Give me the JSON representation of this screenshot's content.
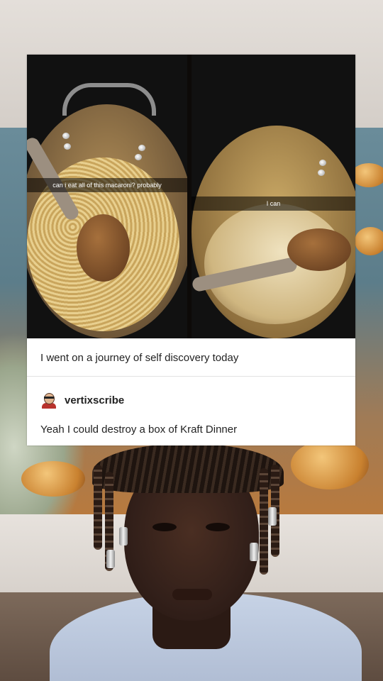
{
  "post": {
    "photo_left_caption": "can i eat all of this macaroni? probably",
    "photo_right_caption": "I can",
    "text": "I went on a journey of self discovery today"
  },
  "reply": {
    "username": "vertixscribe",
    "avatar": "user-avatar-icon",
    "text": "Yeah I could destroy a box of Kraft Dinner"
  },
  "colors": {
    "card_background": "#ffffff",
    "text": "#222222",
    "caption_bar": "rgba(0,0,0,0.55)",
    "sweater": "#c7d3e6"
  }
}
